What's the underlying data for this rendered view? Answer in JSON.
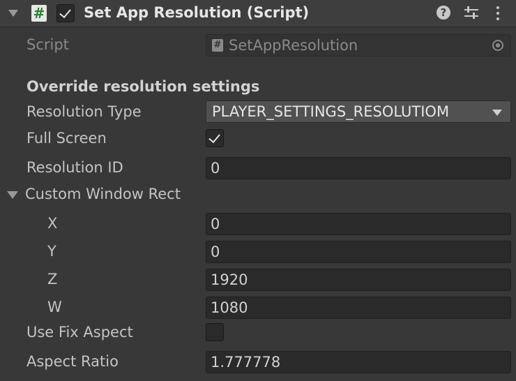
{
  "header": {
    "title": "Set App Resolution (Script)",
    "icons": [
      "fold-arrow-icon",
      "script-icon",
      "checkbox-icon",
      "help-icon",
      "preset-settings-icon",
      "kebab-menu-icon"
    ]
  },
  "script_row": {
    "label": "Script",
    "value": "SetAppResolution"
  },
  "section_title": "Override resolution settings",
  "resolution_type": {
    "label": "Resolution Type",
    "value": "PLAYER_SETTINGS_RESOLUTIOM"
  },
  "full_screen": {
    "label": "Full Screen",
    "checked": true
  },
  "resolution_id": {
    "label": "Resolution ID",
    "value": "0"
  },
  "custom_window_rect": {
    "label": "Custom Window Rect",
    "x": {
      "label": "X",
      "value": "0"
    },
    "y": {
      "label": "Y",
      "value": "0"
    },
    "z": {
      "label": "Z",
      "value": "1920"
    },
    "w": {
      "label": "W",
      "value": "1080"
    }
  },
  "use_fix_aspect": {
    "label": "Use Fix Aspect",
    "checked": false
  },
  "aspect_ratio": {
    "label": "Aspect Ratio",
    "value": "1.777778"
  },
  "colors": {
    "background": "#383838",
    "header": "#3e3e3e",
    "field": "#2a2a2a",
    "dropdown": "#515151",
    "script_icon_green": "#2e7d32"
  }
}
